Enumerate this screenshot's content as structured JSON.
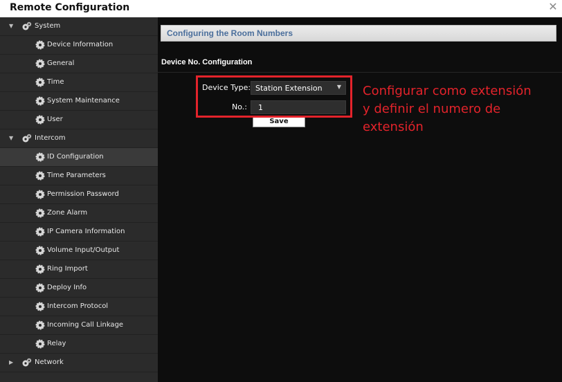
{
  "window": {
    "title": "Remote Configuration",
    "close_glyph": "✕"
  },
  "sidebar": {
    "groups": [
      {
        "label": "System",
        "expanded": true,
        "icon": "gear-group-icon"
      },
      {
        "label": "Intercom",
        "expanded": true,
        "icon": "gear-group-icon"
      },
      {
        "label": "Network",
        "expanded": false,
        "icon": "gear-group-icon"
      }
    ],
    "system_items": [
      "Device Information",
      "General",
      "Time",
      "System Maintenance",
      "User"
    ],
    "intercom_items": [
      "ID Configuration",
      "Time Parameters",
      "Permission Password",
      "Zone Alarm",
      "IP Camera Information",
      "Volume Input/Output",
      "Ring Import",
      "Deploy Info",
      "Intercom Protocol",
      "Incoming Call Linkage",
      "Relay"
    ],
    "selected": "ID Configuration",
    "icon": "gear-icon"
  },
  "main": {
    "section_title": "Configuring the Room Numbers",
    "subtitle": "Device No. Configuration",
    "device_type_label": "Device Type:",
    "device_type_value": "Station Extension",
    "number_label": "No.:",
    "number_value": "1",
    "save_label": "Save"
  },
  "annotation": {
    "lines": [
      "Configurar como extensión",
      "y definir el numero de",
      "extensión"
    ],
    "color": "#e3232b"
  },
  "colors": {
    "sidebar_bg": "#2b2b2b",
    "main_bg": "#0d0d0d",
    "section_title": "#4b6f9c",
    "highlight": "#e3232b"
  }
}
